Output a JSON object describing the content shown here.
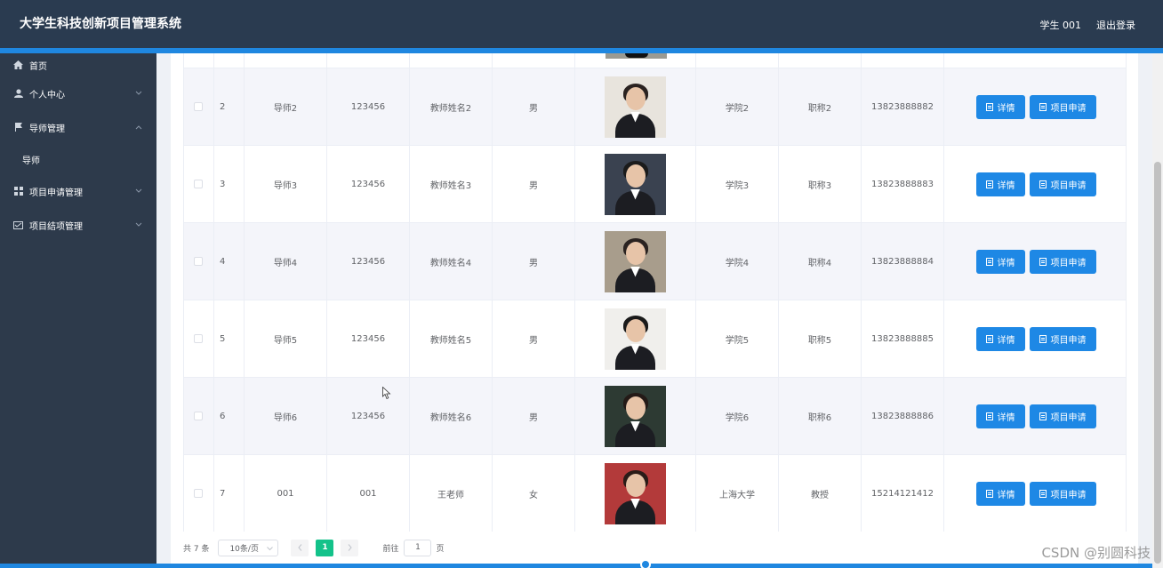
{
  "header": {
    "app_title": "大学生科技创新项目管理系统",
    "user_name": "学生 001",
    "logout_label": "退出登录"
  },
  "sidebar": {
    "items": [
      {
        "label": "首页",
        "icon": "home-icon"
      },
      {
        "label": "个人中心",
        "icon": "user-icon"
      },
      {
        "label": "导师管理",
        "icon": "flag-icon",
        "expanded": true
      },
      {
        "label": "项目申请管理",
        "icon": "grid-icon"
      },
      {
        "label": "项目结项管理",
        "icon": "inbox-icon"
      }
    ],
    "sub_item_label": "导师"
  },
  "table": {
    "rows": [
      {
        "index": "2",
        "account": "导师2",
        "password": "123456",
        "name": "教师姓名2",
        "gender": "男",
        "college": "学院2",
        "title": "职称2",
        "phone": "13823888882"
      },
      {
        "index": "3",
        "account": "导师3",
        "password": "123456",
        "name": "教师姓名3",
        "gender": "男",
        "college": "学院3",
        "title": "职称3",
        "phone": "13823888883"
      },
      {
        "index": "4",
        "account": "导师4",
        "password": "123456",
        "name": "教师姓名4",
        "gender": "男",
        "college": "学院4",
        "title": "职称4",
        "phone": "13823888884"
      },
      {
        "index": "5",
        "account": "导师5",
        "password": "123456",
        "name": "教师姓名5",
        "gender": "男",
        "college": "学院5",
        "title": "职称5",
        "phone": "13823888885"
      },
      {
        "index": "6",
        "account": "导师6",
        "password": "123456",
        "name": "教师姓名6",
        "gender": "男",
        "college": "学院6",
        "title": "职称6",
        "phone": "13823888886"
      },
      {
        "index": "7",
        "account": "001",
        "password": "001",
        "name": "王老师",
        "gender": "女",
        "college": "上海大学",
        "title": "教授",
        "phone": "15214121412"
      }
    ],
    "detail_label": "详情",
    "apply_label": "项目申请"
  },
  "pagination": {
    "total": "共 7 条",
    "page_size": "10条/页",
    "current_page": "1",
    "goto_label": "前往",
    "goto_value": "1",
    "page_unit": "页"
  },
  "watermark": "CSDN @别圆科技",
  "colors": {
    "header_bg": "#2a3b50",
    "sidebar_bg": "#2d3a4b",
    "accent": "#1f87e0",
    "button": "#1e88e5",
    "active_page": "#13c28a"
  }
}
